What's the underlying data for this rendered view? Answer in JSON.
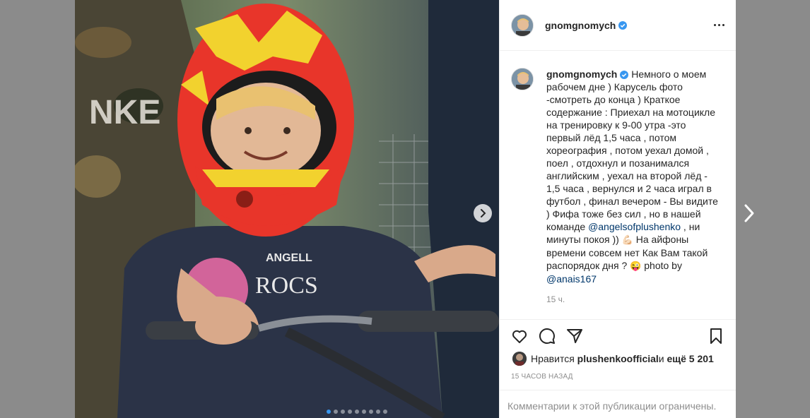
{
  "post": {
    "username": "gnomgnomych",
    "caption_lines": [
      "Немного о моем",
      "рабочем дне ) Карусель фото",
      "-смотреть до конца ) Краткое",
      "содержание : Приехал на мотоцикле",
      "на тренировку к 9-00 утра -это",
      "первый лёд 1,5 часа , потом",
      "хореография , потом уехал домой ,",
      "поел , отдохнул и позанимался",
      "английским , уехал на второй лёд -",
      "1,5 часа , вернулся и 2 часа играл в",
      "футбол , финал вечером - Вы видите",
      ") Фифа тоже без сил , но в нашей"
    ],
    "caption_team_prefix": "команде ",
    "mention_1": "@angelsofplushenko",
    "caption_after_mention": " , ни",
    "caption_line_peace": "минуты покоя )) ",
    "emoji_1": "💪🏻",
    "caption_iphones": " На айфоны",
    "caption_time": "времени совсем нет Как Вам такой",
    "caption_schedule": "распорядок дня ? ",
    "emoji_2": "😜",
    "caption_photo_by": " photo by",
    "mention_2": "@anais167",
    "time_ago": "15 ч.",
    "likes_prefix": "Нравится ",
    "likes_user": "plushenkoofficial",
    "likes_and": " и ",
    "likes_more": "ещё 5 201",
    "posted_ago": "15 ЧАСОВ НАЗАД",
    "comments_disabled": "Комментарии к этой публикации ограничены."
  },
  "carousel": {
    "total_slides": 9,
    "active_index": 0
  },
  "colors": {
    "verified": "#3897f0",
    "mention": "#00376b",
    "muted": "#8e8e8e",
    "helmet": "#e8352a",
    "helmet_accent": "#f2d22e"
  },
  "icons": [
    "verified-badge-icon",
    "more-options-icon",
    "heart-icon",
    "comment-icon",
    "share-icon",
    "bookmark-icon",
    "chevron-right-icon"
  ]
}
